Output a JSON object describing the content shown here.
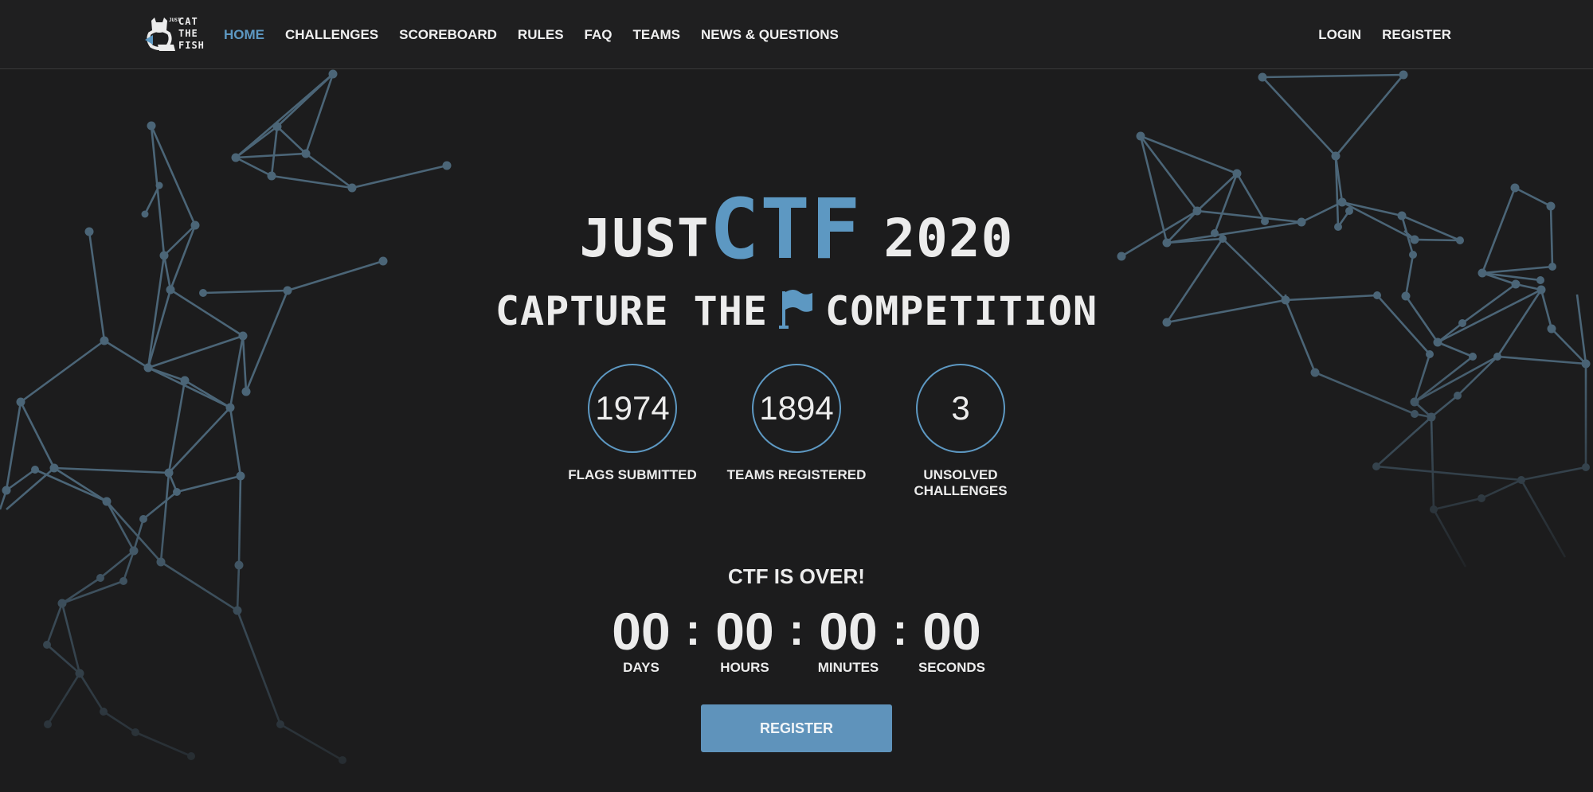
{
  "header": {
    "logo": {
      "small_text": "JUST",
      "line1": "CAT",
      "line2": "THE",
      "line3": "FISH"
    },
    "nav": [
      {
        "label": "HOME",
        "active": true
      },
      {
        "label": "CHALLENGES"
      },
      {
        "label": "SCOREBOARD"
      },
      {
        "label": "RULES"
      },
      {
        "label": "FAQ"
      },
      {
        "label": "TEAMS"
      },
      {
        "label": "NEWS & QUESTIONS"
      }
    ],
    "auth": {
      "login": "LOGIN",
      "register": "REGISTER"
    }
  },
  "hero": {
    "title_just": "JUST",
    "title_ctf": "CTF",
    "title_year": "2020",
    "subtitle_left": "CAPTURE THE",
    "subtitle_right": "COMPETITION",
    "stats": [
      {
        "value": "1974",
        "label": "FLAGS SUBMITTED"
      },
      {
        "value": "1894",
        "label": "TEAMS REGISTERED"
      },
      {
        "value": "3",
        "label": "UNSOLVED CHALLENGES"
      }
    ],
    "status": "CTF IS OVER!",
    "countdown": [
      {
        "value": "00",
        "label": "DAYS"
      },
      {
        "value": "00",
        "label": "HOURS"
      },
      {
        "value": "00",
        "label": "MINUTES"
      },
      {
        "value": "00",
        "label": "SECONDS"
      }
    ],
    "separator": ":",
    "register_button": "REGISTER"
  },
  "colors": {
    "background": "#1c1c1d",
    "accent": "#5d98c2",
    "network_lines": "#4b6577",
    "button": "#5f93bb"
  }
}
